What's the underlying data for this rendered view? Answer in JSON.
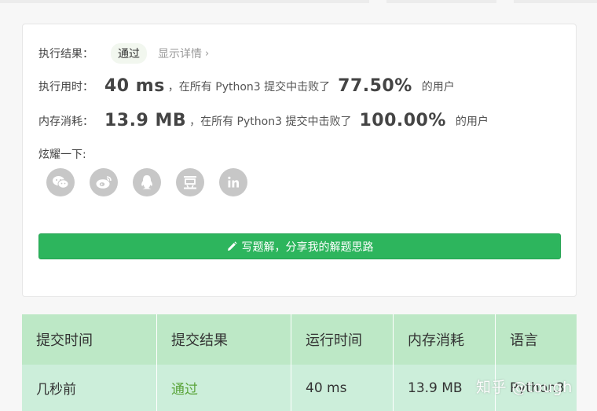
{
  "result": {
    "label": "执行结果：",
    "status": "通过",
    "detail_link": "显示详情",
    "chevron": "›"
  },
  "runtime": {
    "label": "执行用时：",
    "value": "40 ms",
    "mid_text": "，在所有 Python3 提交中击败了",
    "percent": "77.50%",
    "tail": "的用户"
  },
  "memory": {
    "label": "内存消耗：",
    "value": "13.9 MB",
    "mid_text": "，在所有 Python3 提交中击败了",
    "percent": "100.00%",
    "tail": "的用户"
  },
  "share": {
    "label": "炫耀一下:",
    "icons": [
      "wechat-icon",
      "weibo-icon",
      "qq-icon",
      "douban-icon",
      "linkedin-icon"
    ]
  },
  "write_button": {
    "label": "写题解，分享我的解题思路"
  },
  "table": {
    "headers": [
      "提交时间",
      "提交结果",
      "运行时间",
      "内存消耗",
      "语言"
    ],
    "row": [
      "几秒前",
      "通过",
      "40 ms",
      "13.9 MB",
      "Python3"
    ]
  },
  "watermark": "知乎 @tough",
  "colors": {
    "accent_green": "#2db55d",
    "pass_green": "#5aa43a",
    "table_header": "#bde8c6",
    "table_row": "#cceeda",
    "icon_grey": "#c7c7c7"
  }
}
